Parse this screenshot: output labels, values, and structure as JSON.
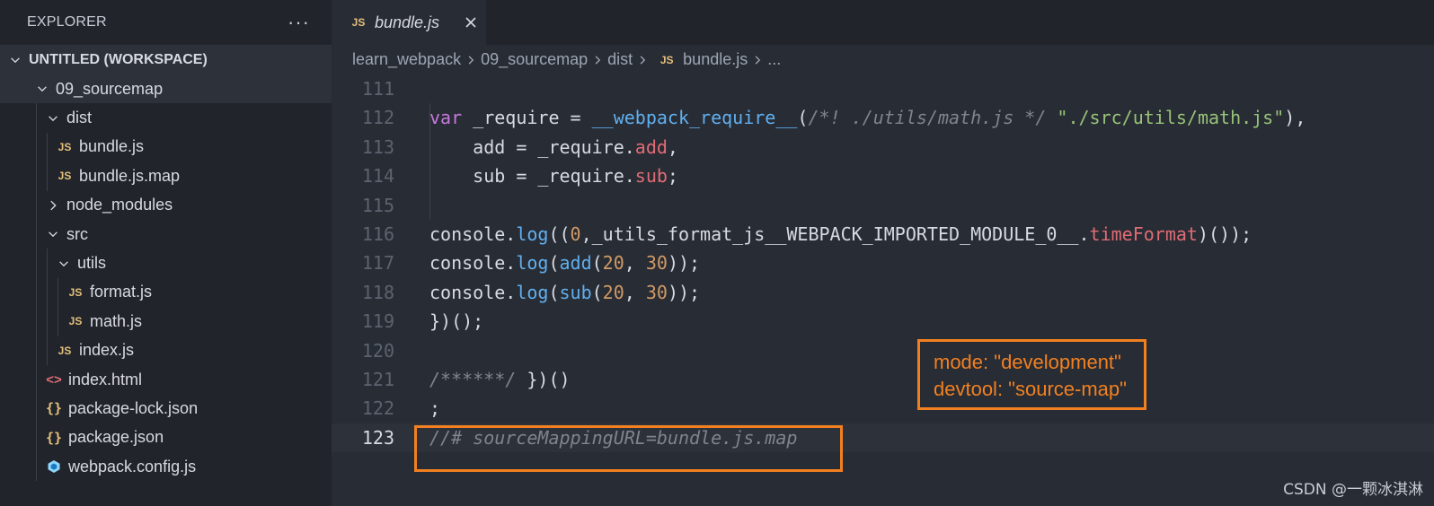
{
  "sidebar": {
    "title": "EXPLORER",
    "more_label": "···",
    "workspace_label": "UNTITLED (WORKSPACE)",
    "tree": [
      {
        "label": "09_sourcemap",
        "icon": "chevron-down-icon",
        "type": "folder"
      },
      {
        "label": "dist",
        "icon": "chevron-down-icon",
        "type": "folder"
      },
      {
        "label": "bundle.js",
        "icon": "js-file-icon",
        "type": "file"
      },
      {
        "label": "bundle.js.map",
        "icon": "js-file-icon",
        "type": "file"
      },
      {
        "label": "node_modules",
        "icon": "chevron-right-icon",
        "type": "folder"
      },
      {
        "label": "src",
        "icon": "chevron-down-icon",
        "type": "folder"
      },
      {
        "label": "utils",
        "icon": "chevron-down-icon",
        "type": "folder"
      },
      {
        "label": "format.js",
        "icon": "js-file-icon",
        "type": "file"
      },
      {
        "label": "math.js",
        "icon": "js-file-icon",
        "type": "file"
      },
      {
        "label": "index.js",
        "icon": "js-file-icon",
        "type": "file"
      },
      {
        "label": "index.html",
        "icon": "html-file-icon",
        "type": "file"
      },
      {
        "label": "package-lock.json",
        "icon": "json-file-icon",
        "type": "file"
      },
      {
        "label": "package.json",
        "icon": "json-file-icon",
        "type": "file"
      },
      {
        "label": "webpack.config.js",
        "icon": "webpack-icon",
        "type": "file"
      }
    ]
  },
  "icons": {
    "js_badge": "JS",
    "html_badge": "<>",
    "json_badge": "{}"
  },
  "tab": {
    "title": "bundle.js",
    "close": "×"
  },
  "breadcrumb": {
    "items": [
      "learn_webpack",
      "09_sourcemap",
      "dist",
      "bundle.js",
      "..."
    ]
  },
  "code": {
    "lines": [
      {
        "n": "111",
        "tokens": []
      },
      {
        "n": "112",
        "tokens": [
          [
            "kw",
            "var"
          ],
          [
            "plain",
            " _require = "
          ],
          [
            "fn",
            "__webpack_require__"
          ],
          [
            "plain",
            "("
          ],
          [
            "com",
            "/*! ./utils/math.js */"
          ],
          [
            "plain",
            " "
          ],
          [
            "str",
            "\"./src/utils/math.js\""
          ],
          [
            "plain",
            "),"
          ]
        ]
      },
      {
        "n": "113",
        "tokens": [
          [
            "plain",
            "    add = _require."
          ],
          [
            "prop",
            "add"
          ],
          [
            "plain",
            ","
          ]
        ]
      },
      {
        "n": "114",
        "tokens": [
          [
            "plain",
            "    sub = _require."
          ],
          [
            "prop",
            "sub"
          ],
          [
            "plain",
            ";"
          ]
        ]
      },
      {
        "n": "115",
        "tokens": []
      },
      {
        "n": "116",
        "tokens": [
          [
            "plain",
            "console."
          ],
          [
            "fn",
            "log"
          ],
          [
            "plain",
            "(("
          ],
          [
            "num",
            "0"
          ],
          [
            "plain",
            ",_utils_format_js__WEBPACK_IMPORTED_MODULE_0__."
          ],
          [
            "prop",
            "timeFormat"
          ],
          [
            "plain",
            ")());"
          ]
        ]
      },
      {
        "n": "117",
        "tokens": [
          [
            "plain",
            "console."
          ],
          [
            "fn",
            "log"
          ],
          [
            "plain",
            "("
          ],
          [
            "fn",
            "add"
          ],
          [
            "plain",
            "("
          ],
          [
            "num",
            "20"
          ],
          [
            "plain",
            ", "
          ],
          [
            "num",
            "30"
          ],
          [
            "plain",
            "));"
          ]
        ]
      },
      {
        "n": "118",
        "tokens": [
          [
            "plain",
            "console."
          ],
          [
            "fn",
            "log"
          ],
          [
            "plain",
            "("
          ],
          [
            "fn",
            "sub"
          ],
          [
            "plain",
            "("
          ],
          [
            "num",
            "20"
          ],
          [
            "plain",
            ", "
          ],
          [
            "num",
            "30"
          ],
          [
            "plain",
            "));"
          ]
        ]
      },
      {
        "n": "119",
        "tokens": [
          [
            "plain",
            "})();"
          ]
        ]
      },
      {
        "n": "120",
        "tokens": []
      },
      {
        "n": "121",
        "tokens": [
          [
            "com",
            "/******/"
          ],
          [
            "plain",
            " })()"
          ]
        ]
      },
      {
        "n": "122",
        "tokens": [
          [
            "plain",
            ";"
          ]
        ]
      },
      {
        "n": "123",
        "tokens": [
          [
            "com",
            "//# sourceMappingURL=bundle.js.map"
          ]
        ],
        "current": true
      }
    ]
  },
  "annotation": {
    "lines": [
      "mode: \"development\"",
      "devtool: \"source-map\""
    ],
    "color": "#f28021"
  },
  "watermark": "CSDN @一颗冰淇淋"
}
